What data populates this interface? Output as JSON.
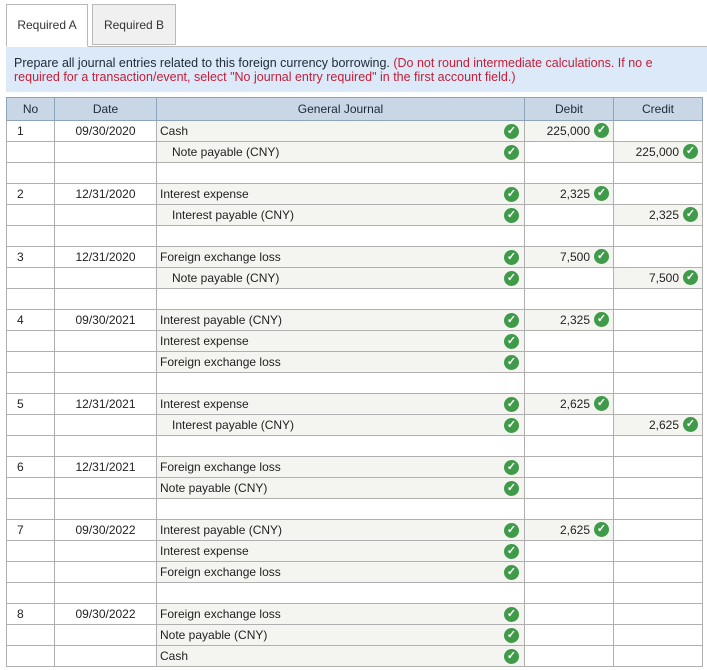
{
  "tabs": [
    {
      "label": "Required A",
      "active": true
    },
    {
      "label": "Required B",
      "active": false
    }
  ],
  "instruction": {
    "main": "Prepare all journal entries related to this foreign currency borrowing. ",
    "note_line1": "(Do not round intermediate calculations. If no e",
    "note_line2": "required for a transaction/event, select \"No journal entry required\" in the first account field.)"
  },
  "table": {
    "headers": {
      "no": "No",
      "date": "Date",
      "journal": "General Journal",
      "debit": "Debit",
      "credit": "Credit"
    },
    "groups": [
      {
        "no": "1",
        "date": "09/30/2020",
        "rows": [
          {
            "account": "Cash",
            "indent": false,
            "debit": "225,000",
            "credit": ""
          },
          {
            "account": "Note payable (CNY)",
            "indent": true,
            "debit": "",
            "credit": "225,000"
          }
        ]
      },
      {
        "no": "2",
        "date": "12/31/2020",
        "rows": [
          {
            "account": "Interest expense",
            "indent": false,
            "debit": "2,325",
            "credit": ""
          },
          {
            "account": "Interest payable (CNY)",
            "indent": true,
            "debit": "",
            "credit": "2,325"
          }
        ]
      },
      {
        "no": "3",
        "date": "12/31/2020",
        "rows": [
          {
            "account": "Foreign exchange loss",
            "indent": false,
            "debit": "7,500",
            "credit": ""
          },
          {
            "account": "Note payable (CNY)",
            "indent": true,
            "debit": "",
            "credit": "7,500"
          }
        ]
      },
      {
        "no": "4",
        "date": "09/30/2021",
        "rows": [
          {
            "account": "Interest payable (CNY)",
            "indent": false,
            "debit": "2,325",
            "credit": ""
          },
          {
            "account": "Interest expense",
            "indent": false,
            "debit": "",
            "credit": ""
          },
          {
            "account": "Foreign exchange loss",
            "indent": false,
            "debit": "",
            "credit": ""
          }
        ]
      },
      {
        "no": "5",
        "date": "12/31/2021",
        "rows": [
          {
            "account": "Interest expense",
            "indent": false,
            "debit": "2,625",
            "credit": ""
          },
          {
            "account": "Interest payable (CNY)",
            "indent": true,
            "debit": "",
            "credit": "2,625"
          }
        ]
      },
      {
        "no": "6",
        "date": "12/31/2021",
        "rows": [
          {
            "account": "Foreign exchange loss",
            "indent": false,
            "debit": "",
            "credit": ""
          },
          {
            "account": "Note payable (CNY)",
            "indent": false,
            "debit": "",
            "credit": ""
          }
        ]
      },
      {
        "no": "7",
        "date": "09/30/2022",
        "rows": [
          {
            "account": "Interest payable (CNY)",
            "indent": false,
            "debit": "2,625",
            "credit": ""
          },
          {
            "account": "Interest expense",
            "indent": false,
            "debit": "",
            "credit": ""
          },
          {
            "account": "Foreign exchange loss",
            "indent": false,
            "debit": "",
            "credit": ""
          }
        ]
      },
      {
        "no": "8",
        "date": "09/30/2022",
        "rows": [
          {
            "account": "Foreign exchange loss",
            "indent": false,
            "debit": "",
            "credit": ""
          },
          {
            "account": "Note payable (CNY)",
            "indent": false,
            "debit": "",
            "credit": ""
          },
          {
            "account": "Cash",
            "indent": false,
            "debit": "",
            "credit": ""
          }
        ]
      }
    ]
  },
  "colors": {
    "check": "#3f9a4a",
    "header_bg": "#c8d6e5",
    "instruction_bg": "#dbe9f8",
    "note_red": "#c2203a"
  },
  "icons": {
    "check": "check-circle-icon"
  }
}
